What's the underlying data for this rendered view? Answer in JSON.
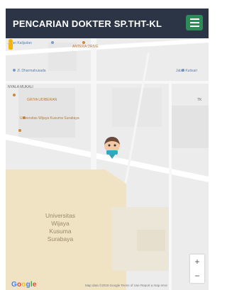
{
  "header": {
    "title": "PENCARIAN DOKTER SP.THT-KL",
    "menu_icon": "hamburger-menu-icon"
  },
  "map": {
    "labels": [
      "Jalan Kalijudan",
      "ANTERA DRIVE",
      "Jl. Dharmahusada",
      "Jalan Kutisari",
      "NYALA MUKALI",
      "GRIYA UDIBERAN",
      "TK",
      "Universitas Wijaya Kusuma Surabaya"
    ],
    "campus_name_lines": [
      "Universitas",
      "Wijaya",
      "Kusuma",
      "Surabaya"
    ],
    "user_marker_icon": "doctor-avatar-icon",
    "zoom_in": "+",
    "zoom_out": "−",
    "pegman_icon": "pegman-icon",
    "google_logo": "Google",
    "footer": "Map data ©2019 Google   Terms of Use   Report a map error"
  },
  "colors": {
    "header_bg": "#2b3546",
    "menu_btn": "#2e8b57",
    "map_bg": "#ececec",
    "campus": "#efe3c4"
  }
}
